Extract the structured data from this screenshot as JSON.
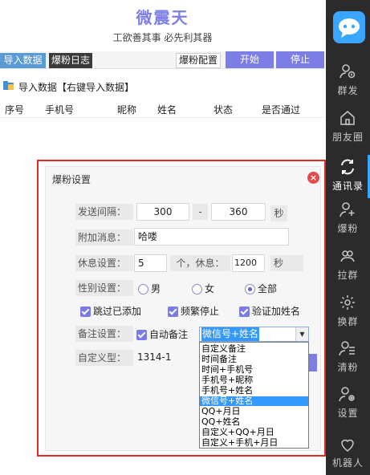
{
  "app": {
    "title": "微震天",
    "subtitle": "工欲善其事 必先利其器"
  },
  "toolbar": {
    "tab_import": "导入数据",
    "tab_log": "爆粉日志",
    "config_label": "爆粉配置",
    "start_label": "开始",
    "stop_label": "停止"
  },
  "section": {
    "title": "导入数据【右键导入数据】"
  },
  "table": {
    "columns": [
      "序号",
      "手机号",
      "昵称",
      "姓名",
      "状态",
      "是否通过"
    ]
  },
  "sidebar": {
    "items": [
      {
        "label": "群发",
        "icon": "group-send-icon"
      },
      {
        "label": "朋友圈",
        "icon": "moments-icon"
      },
      {
        "label": "通讯录",
        "icon": "contacts-sync-icon",
        "active": true
      },
      {
        "label": "爆粉",
        "icon": "add-fans-icon"
      },
      {
        "label": "拉群",
        "icon": "pull-group-icon"
      },
      {
        "label": "换群",
        "icon": "switch-group-icon"
      },
      {
        "label": "清粉",
        "icon": "clean-fans-icon"
      },
      {
        "label": "设置",
        "icon": "settings-icon"
      },
      {
        "label": "机器人",
        "icon": "robot-icon"
      }
    ]
  },
  "dialog": {
    "title": "爆粉设置",
    "interval": {
      "label": "发送间隔：",
      "min": "300",
      "sep": "-",
      "max": "360",
      "unit": "秒"
    },
    "message": {
      "label": "附加消息：",
      "value": "哈喽"
    },
    "rest": {
      "label": "休息设置：",
      "count": "5",
      "mid": "个，休息：",
      "seconds": "1200",
      "unit": "秒"
    },
    "gender": {
      "label": "性别设置：",
      "options": [
        "男",
        "女",
        "全部"
      ],
      "selected": "全部"
    },
    "options": {
      "skip_added": "跳过已添加",
      "frequent_stop": "频繁停止",
      "verify_name": "验证加姓名"
    },
    "remark": {
      "label": "备注设置：",
      "auto_label": "自动备注",
      "selected": "微信号+姓名",
      "dropdown": [
        "自定义备注",
        "时间备注",
        "时间+手机号",
        "手机号+昵称",
        "手机号+姓名",
        "微信号+姓名",
        "QQ+月日",
        "QQ+姓名",
        "自定义+QQ+月日",
        "自定义+手机+月日"
      ]
    },
    "custom": {
      "label": "自定义型：",
      "value": "1314-1"
    }
  },
  "colors": {
    "accent": "#7d7de6",
    "sidebar": "#2b2b2b",
    "highlight": "#3399ff",
    "frame": "#e02b20"
  }
}
